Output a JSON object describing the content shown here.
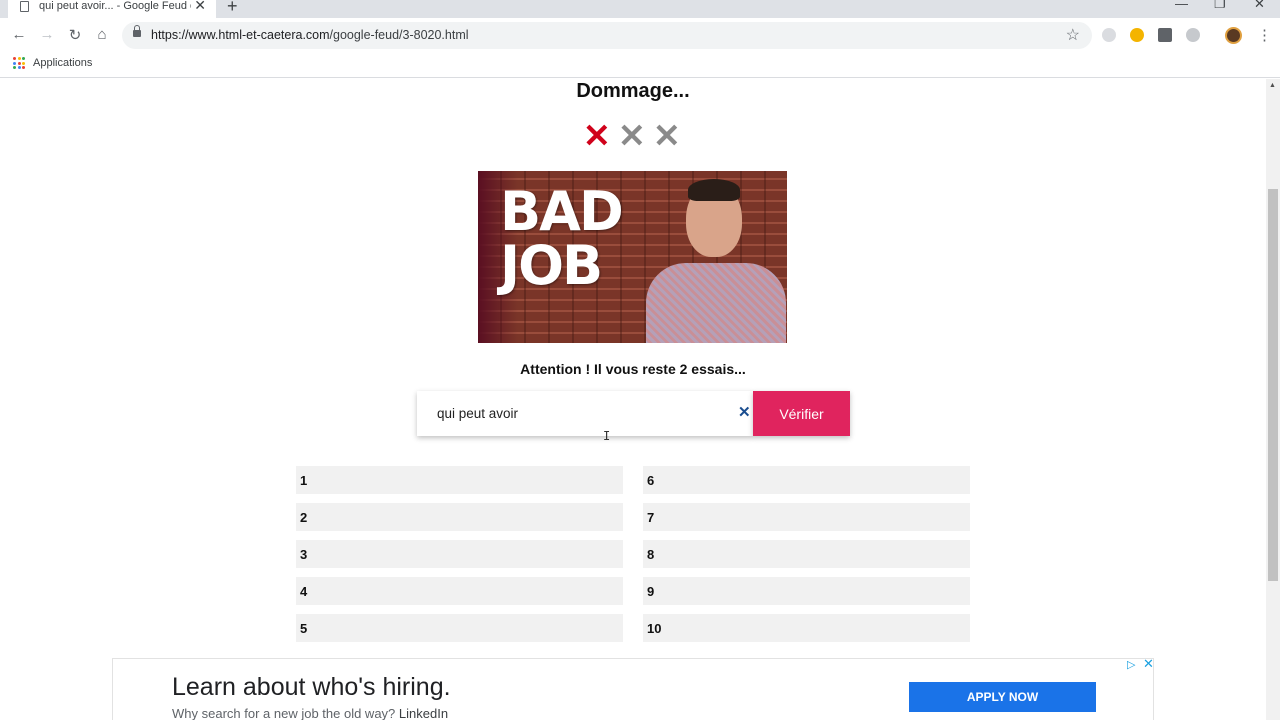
{
  "browser": {
    "tab_title": "qui peut avoir... - Google Feud et",
    "tab_close": "✕",
    "new_tab": "+",
    "url_host": "https://www.html-et-caetera.com",
    "url_path": "/google-feud/3-8020.html",
    "bookmarks_label": "Applications",
    "window_controls": [
      "—",
      "❐",
      "✕"
    ]
  },
  "game": {
    "heading": "Dommage...",
    "strikes": {
      "used": 1,
      "total": 3
    },
    "gif_text_line1": "BAD",
    "gif_text_line2": "JOB",
    "warning": "Attention ! Il vous reste 2 essais...",
    "search_value": "qui peut avoir",
    "clear_label": "✕",
    "verify_label": "Vérifier",
    "answers": [
      "1",
      "2",
      "3",
      "4",
      "5",
      "6",
      "7",
      "8",
      "9",
      "10"
    ]
  },
  "ad": {
    "title": "Learn about who's hiring.",
    "subtitle": "Why search for a new job the old way?",
    "brand": "LinkedIn",
    "button": "APPLY NOW"
  },
  "colors": {
    "accent": "#e0245e",
    "strike_active": "#d0021b",
    "strike_inactive": "#8a8a8a",
    "ad_button": "#1a73e8"
  }
}
